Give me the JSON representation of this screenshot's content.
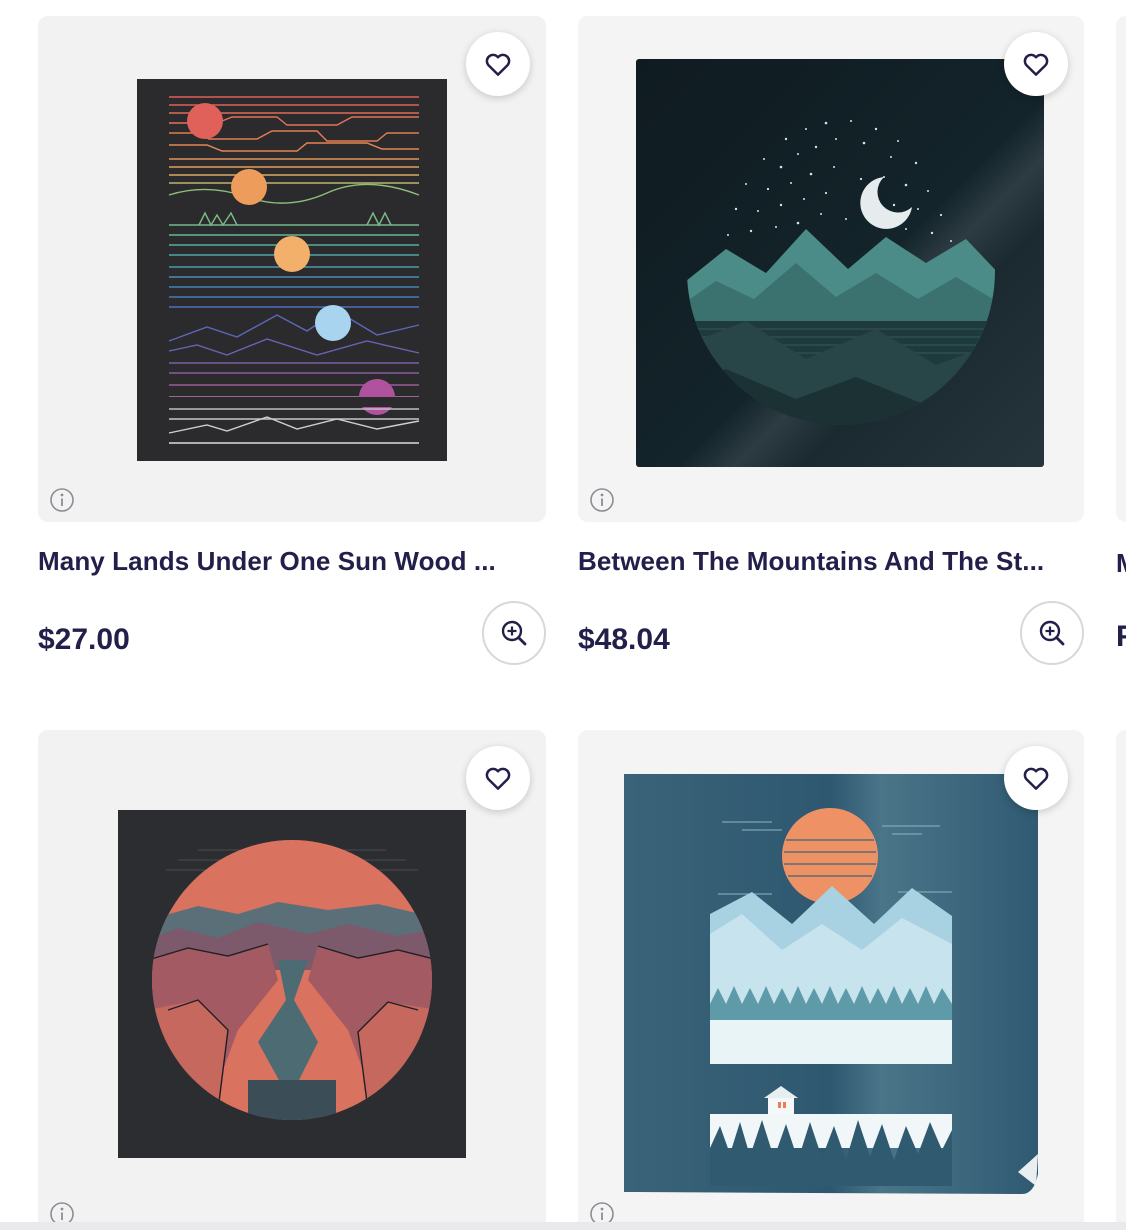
{
  "products": [
    {
      "title": "Many Lands Under One Sun Wood ...",
      "price": "$27.00",
      "art": "many-lands-under-one-sun"
    },
    {
      "title": "Between The Mountains And The St...",
      "price": "$48.04",
      "art": "between-the-mountains-and-the-stars"
    },
    {
      "art": "canyon-river-sun"
    },
    {
      "art": "mountain-cabin-sun-poster"
    }
  ],
  "icons": {
    "favorite": "heart-icon",
    "info": "info-icon",
    "zoom": "zoom-in-icon"
  },
  "partial_column": {
    "title_start": "M",
    "price_start": "F"
  },
  "colors": {
    "text": "#22204a",
    "card_bg": "#f4f4f5",
    "border": "#d7d7dc"
  }
}
